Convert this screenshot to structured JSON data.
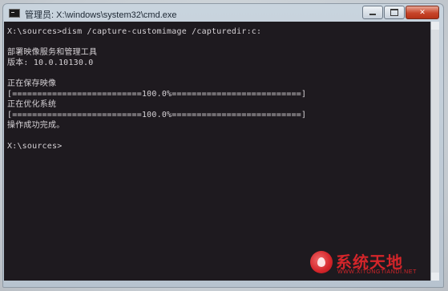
{
  "window": {
    "title": "管理员: X:\\windows\\system32\\cmd.exe",
    "icon": "cmd-icon"
  },
  "caption_buttons": {
    "minimize_icon": "minimize-icon",
    "maximize_icon": "maximize-icon",
    "close_label": "✕"
  },
  "console": {
    "lines": [
      "X:\\sources>dism /capture-customimage /capturedir:c:",
      "",
      "部署映像服务和管理工具",
      "版本: 10.0.10130.0",
      "",
      "正在保存映像",
      "[==========================100.0%==========================]",
      "正在优化系统",
      "[==========================100.0%==========================]",
      "操作成功完成。",
      "",
      "X:\\sources>"
    ]
  },
  "watermark": {
    "title": "系统天地",
    "url": "WWW.XITONGTIANDI.NET",
    "color": "#d4252a"
  },
  "colors": {
    "console_bg": "#1e1a1f",
    "console_fg": "#d6d2d6",
    "close_button": "#c7452a"
  }
}
